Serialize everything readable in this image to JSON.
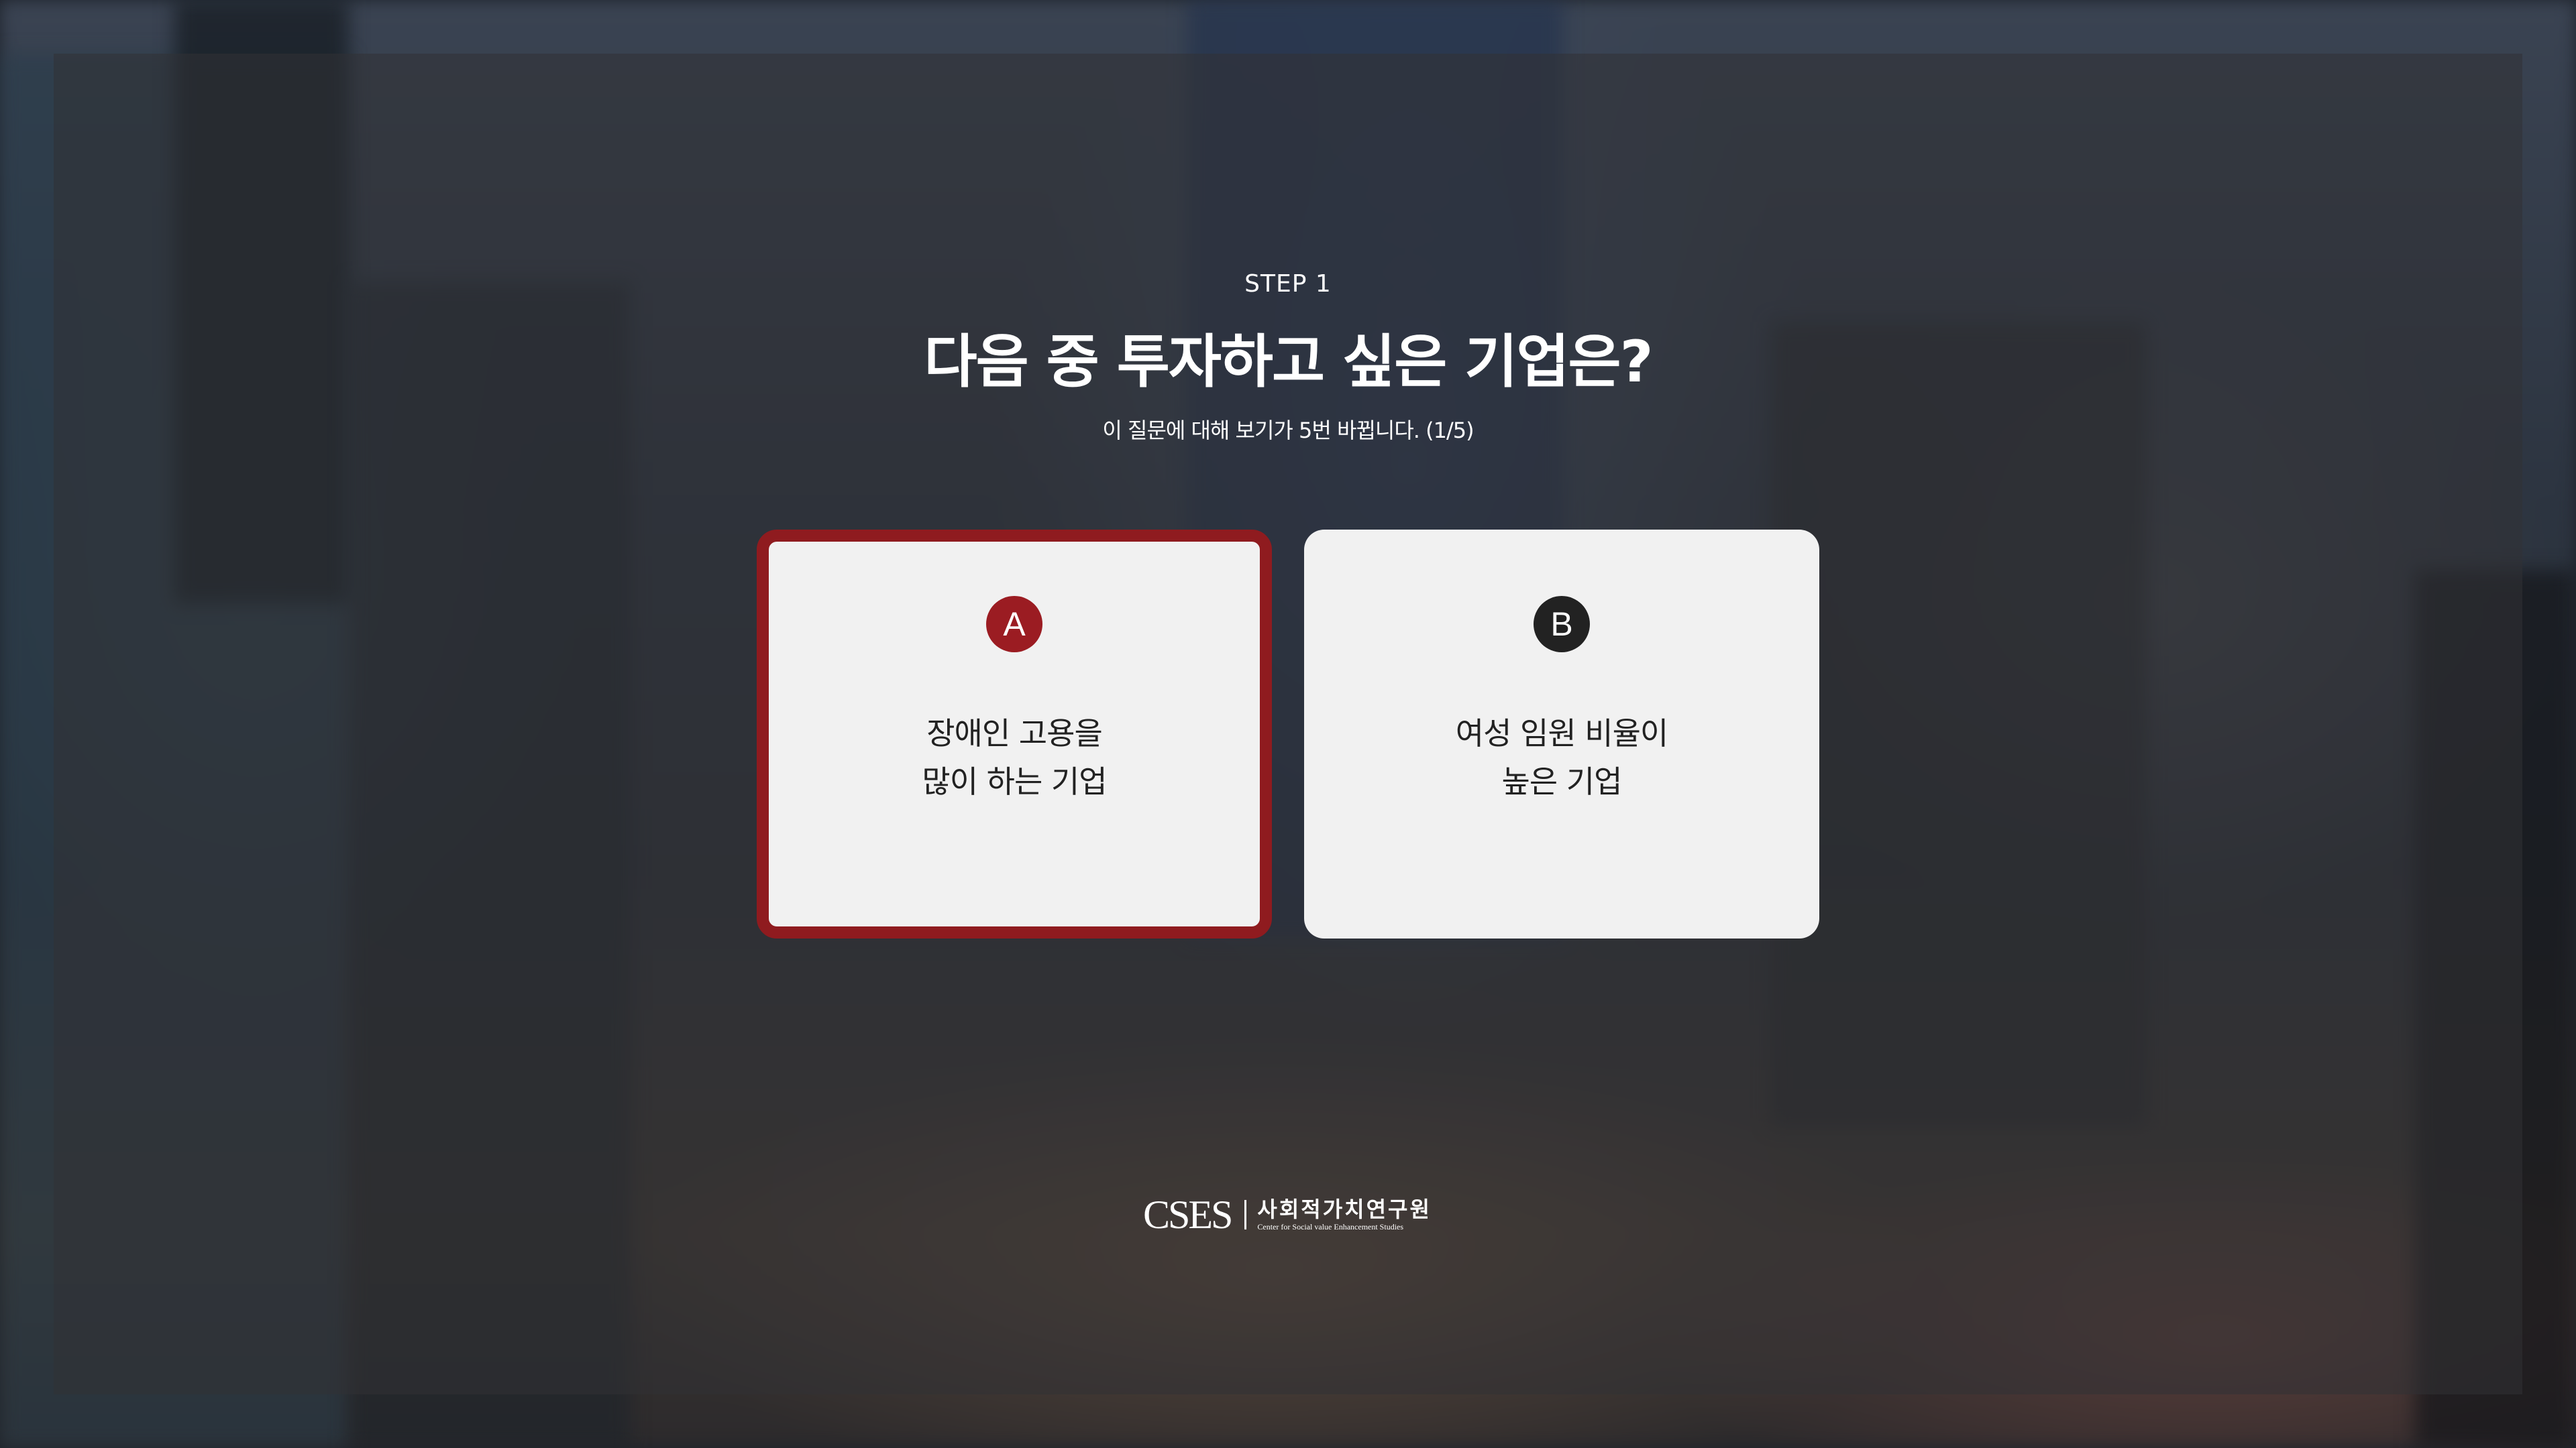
{
  "header": {
    "step": "STEP 1",
    "title": "다음 중 투자하고 싶은 기업은?",
    "subtitle": "이 질문에 대해 보기가 5번 바뀝니다. (1/5)"
  },
  "options": [
    {
      "badge": "A",
      "lines": [
        "장애인 고용을",
        "많이 하는 기업"
      ],
      "selected": true,
      "badge_color": "#9b1c22"
    },
    {
      "badge": "B",
      "lines": [
        "여성 임원 비율이",
        "높은 기업"
      ],
      "selected": false,
      "badge_color": "#222222"
    }
  ],
  "logo": {
    "mark": "CSES",
    "korean": "사회적가치연구원",
    "english": "Center for Social value Enhancement Studies"
  },
  "colors": {
    "accent": "#8f1b1f",
    "card_bg": "#f1f1f1",
    "text_light": "#ffffff",
    "text_dark": "#222222"
  }
}
